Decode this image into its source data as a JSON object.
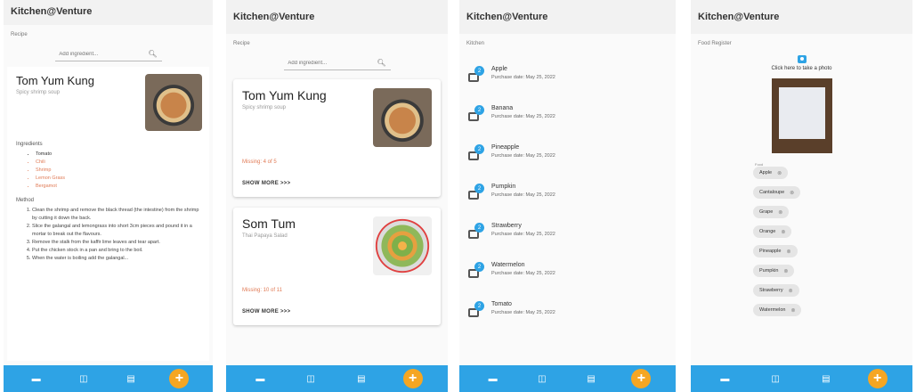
{
  "app_title": "Kitchen@Venture",
  "nav_icons": [
    "home-icon",
    "book-icon",
    "fridge-icon"
  ],
  "fab_label": "+",
  "accent_color": "#2ea3e5",
  "fab_color": "#f5a623",
  "screen1": {
    "section": "Recipe",
    "search_placeholder": "Add ingredient...",
    "title": "Tom Yum Kung",
    "subtitle": "Spicy shrimp soup",
    "ingredients_heading": "Ingredients",
    "ingredients": [
      {
        "name": "Tomato",
        "missing": false
      },
      {
        "name": "Chili",
        "missing": true
      },
      {
        "name": "Shrimp",
        "missing": true
      },
      {
        "name": "Lemon Grass",
        "missing": true
      },
      {
        "name": "Bergamot",
        "missing": true
      }
    ],
    "method_heading": "Method",
    "method": [
      "Clean the shrimp and remove the black thread (the intestine) from the shrimp by cutting it down the back.",
      "Slice the galangal and lemongrass into short 3cm pieces and pound it in a mortar to break out the flavours.",
      "Remove the stalk from the kaffir lime leaves and tear apart.",
      "Put the chicken stock in a pan and bring to the boil.",
      "When the water is boiling add the galangal..."
    ]
  },
  "screen2": {
    "section": "Recipe",
    "search_placeholder": "Add ingredient...",
    "cards": [
      {
        "title": "Tom Yum Kung",
        "subtitle": "Spicy shrimp soup",
        "missing": "Missing: 4 of 5",
        "show_more": "SHOW MORE >>>"
      },
      {
        "title": "Som Tum",
        "subtitle": "Thai Papaya Salad",
        "missing": "Missing: 10 of 11",
        "show_more": "SHOW MORE >>>"
      }
    ]
  },
  "screen3": {
    "section": "Kitchen",
    "items": [
      {
        "name": "Apple",
        "date": "Purchase date: May 25, 2022",
        "badge": "2"
      },
      {
        "name": "Banana",
        "date": "Purchase date: May 25, 2022",
        "badge": "2"
      },
      {
        "name": "Pineapple",
        "date": "Purchase date: May 25, 2022",
        "badge": "2"
      },
      {
        "name": "Pumpkin",
        "date": "Purchase date: May 25, 2022",
        "badge": "2"
      },
      {
        "name": "Strawberry",
        "date": "Purchase date: May 25, 2022",
        "badge": "2"
      },
      {
        "name": "Watermelon",
        "date": "Purchase date: May 25, 2022",
        "badge": "2"
      },
      {
        "name": "Tomato",
        "date": "Purchase date: May 25, 2022",
        "badge": "2"
      }
    ]
  },
  "screen4": {
    "section": "Food Register",
    "take_photo": "Click here to take a photo",
    "food_label": "Food",
    "chips": [
      "Apple",
      "Cantaloupe",
      "Grape",
      "Orange",
      "Pineapple",
      "Pumpkin",
      "Strawberry",
      "Watermelon"
    ]
  }
}
